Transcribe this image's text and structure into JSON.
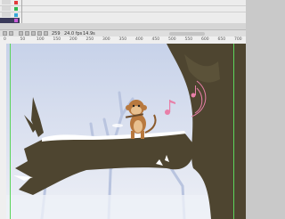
{
  "timeline": {
    "layers": [
      {
        "id": "l1",
        "color": "#e23b3b"
      },
      {
        "id": "l2",
        "color": "#2fb84d"
      },
      {
        "id": "l3",
        "color": "#37a7d8"
      },
      {
        "id": "l4",
        "color": "#c85bd6"
      }
    ]
  },
  "status": {
    "frame": "259",
    "fps": "24.0 fps",
    "time": "14.9s"
  },
  "ruler": {
    "ticks": [
      "0",
      "50",
      "100",
      "150",
      "200",
      "250",
      "300",
      "350",
      "400",
      "450",
      "500",
      "550",
      "600",
      "650",
      "700"
    ]
  },
  "colors": {
    "sky_top": "#c9d4ea",
    "sky_bottom": "#e8ecf5",
    "tree": "#4e4530",
    "snow": "#ffffff",
    "monkey": "#b8793f",
    "note": "#e87fa8"
  },
  "icons": [
    "play-icon",
    "loop-icon",
    "onion-skin-icon",
    "music-note-icon"
  ]
}
